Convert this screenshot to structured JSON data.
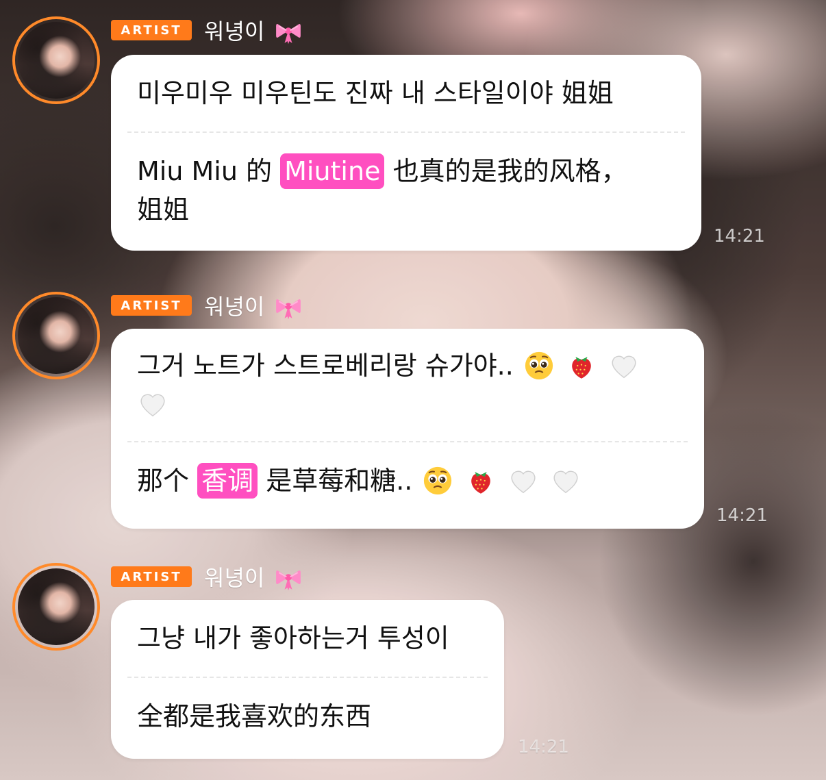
{
  "messages": [
    {
      "artist_badge": "ARTIST",
      "sender_name": "워녕이",
      "name_emoji": "ribbon-icon",
      "korean_text": "미우미우 미우틴도 진짜 내 스타일이야 姐姐",
      "chinese_prefix": "Miu Miu 的",
      "chinese_highlight": "Miutine",
      "chinese_suffix": "也真的是我的风格，",
      "chinese_line2": "姐姐",
      "time": "14:21"
    },
    {
      "artist_badge": "ARTIST",
      "sender_name": "워녕이",
      "name_emoji": "ribbon-icon",
      "korean_text": "그거 노트가 스트로베리랑 슈가야..",
      "korean_emojis": [
        "pleading-face-icon",
        "strawberry-icon",
        "white-heart-icon",
        "white-heart-icon"
      ],
      "chinese_prefix": "那个",
      "chinese_highlight": "香调",
      "chinese_suffix": "是草莓和糖..",
      "chinese_emojis": [
        "pleading-face-icon",
        "strawberry-icon",
        "white-heart-icon",
        "white-heart-icon"
      ],
      "time": "14:21"
    },
    {
      "artist_badge": "ARTIST",
      "sender_name": "워녕이",
      "name_emoji": "ribbon-icon",
      "korean_text": "그냥 내가 좋아하는거 투성이",
      "chinese_text": "全都是我喜欢的东西",
      "time": "14:21"
    }
  ],
  "colors": {
    "artist_badge": "#ff7a1a",
    "avatar_ring": "#ff8a2a",
    "highlight": "#ff4fc0",
    "bubble": "#ffffff",
    "text": "#111111"
  }
}
